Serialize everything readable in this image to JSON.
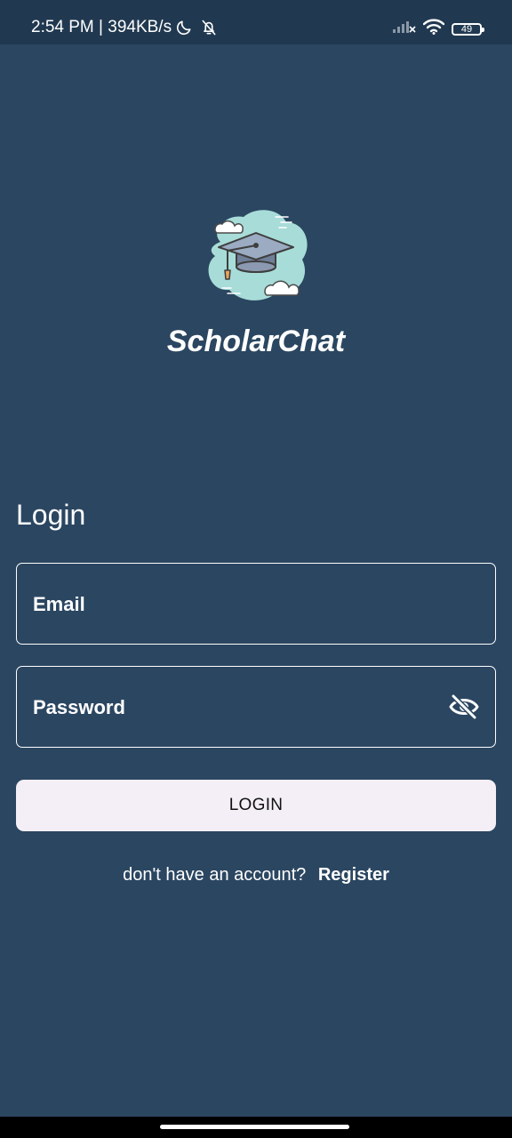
{
  "status_bar": {
    "time": "2:54 PM",
    "separator": " | ",
    "network_speed": "394KB/s",
    "left_icons": [
      "moon-icon",
      "bell-off-icon"
    ],
    "right_icons": [
      "signal-icon",
      "wifi-icon",
      "battery-icon"
    ],
    "battery_level": "49"
  },
  "app": {
    "name": "ScholarChat",
    "logo_icon": "graduation-cap-icon"
  },
  "login": {
    "title": "Login",
    "email_placeholder": "Email",
    "password_placeholder": "Password",
    "visibility_icon": "eye-off-icon",
    "submit_label": "LOGIN",
    "register_prompt": "don't have an account?",
    "register_label": "Register"
  },
  "colors": {
    "background": "#2b4661",
    "status_bar": "#213950",
    "button_bg": "#f4eff7",
    "text": "#ffffff"
  }
}
